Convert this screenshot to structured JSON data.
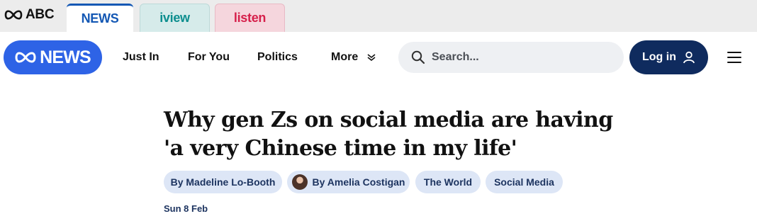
{
  "network_bar": {
    "brand": "ABC",
    "tabs": [
      {
        "label": "NEWS",
        "active": true,
        "color": "#1458b4"
      },
      {
        "label": "iview",
        "active": false,
        "color": "#0c8e8e"
      },
      {
        "label": "listen",
        "active": false,
        "color": "#d6204b"
      }
    ]
  },
  "nav": {
    "logo_text": "NEWS",
    "links": [
      "Just In",
      "For You",
      "Politics",
      "More"
    ],
    "search_placeholder": "Search...",
    "login_label": "Log in"
  },
  "article": {
    "headline": "Why gen Zs on social media are having 'a very Chinese time in my life'",
    "bylines": [
      "By Madeline Lo-Booth",
      "By Amelia Costigan"
    ],
    "topics": [
      "The World",
      "Social Media"
    ],
    "date": "Sun 8 Feb"
  },
  "colors": {
    "news_blue": "#2e63e6",
    "login_navy": "#0f2b5e",
    "chip_bg": "#dde6f6"
  }
}
